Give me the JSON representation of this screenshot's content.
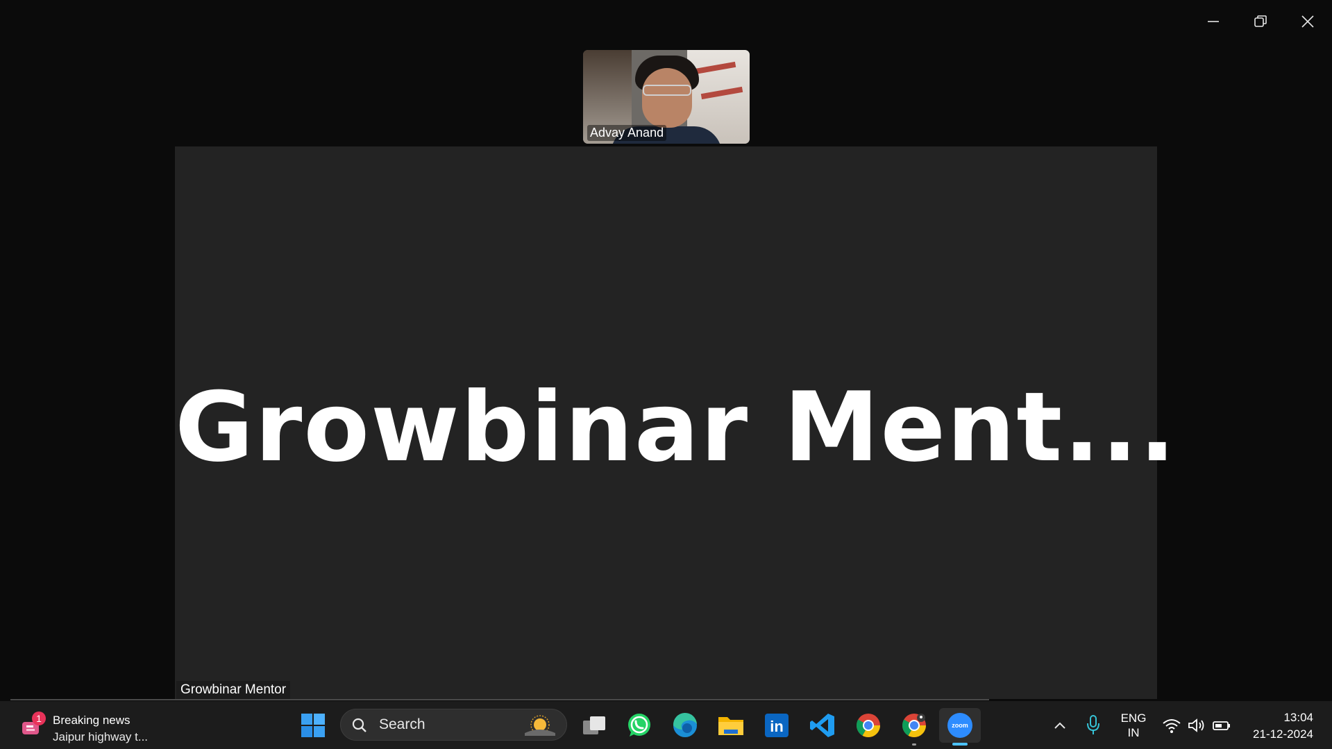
{
  "window": {
    "controls": {
      "minimize": "minimize-icon",
      "restore": "restore-icon",
      "close": "close-icon"
    }
  },
  "meeting": {
    "thumbnail_name": "Advay Anand",
    "main_title": "Growbinar Ment...",
    "main_name_label": "Growbinar Mentor"
  },
  "taskbar": {
    "news": {
      "badge": "1",
      "title": "Breaking news",
      "text": "Jaipur highway t..."
    },
    "search": {
      "label": "Search"
    },
    "apps": [
      "start-icon",
      "task-view-icon",
      "whatsapp-icon",
      "edge-icon",
      "file-explorer-icon",
      "linkedin-icon",
      "vscode-icon",
      "chrome-icon",
      "chrome-profile-icon",
      "zoom-icon"
    ],
    "linkedin_text": "in",
    "zoom_text": "zoom",
    "tray": {
      "lang_line1": "ENG",
      "lang_line2": "IN"
    },
    "clock": {
      "time": "13:04",
      "date": "21-12-2024"
    }
  },
  "colors": {
    "background": "#0b0b0b",
    "stage": "#232323",
    "taskbar": "#1c1c1c",
    "accent": "#4cc2ff"
  }
}
